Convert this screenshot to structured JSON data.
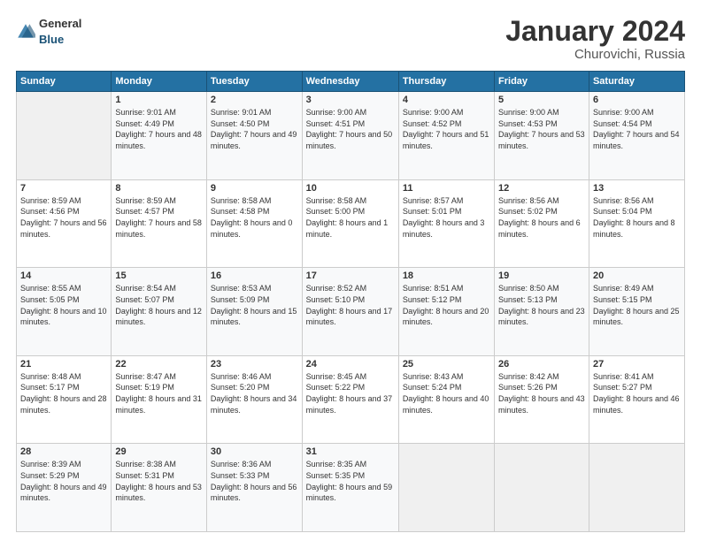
{
  "header": {
    "logo": {
      "general": "General",
      "blue": "Blue"
    },
    "title": "January 2024",
    "location": "Churovichi, Russia"
  },
  "days_of_week": [
    "Sunday",
    "Monday",
    "Tuesday",
    "Wednesday",
    "Thursday",
    "Friday",
    "Saturday"
  ],
  "weeks": [
    [
      {
        "day": "",
        "empty": true
      },
      {
        "day": "1",
        "sunrise": "Sunrise: 9:01 AM",
        "sunset": "Sunset: 4:49 PM",
        "daylight": "Daylight: 7 hours and 48 minutes."
      },
      {
        "day": "2",
        "sunrise": "Sunrise: 9:01 AM",
        "sunset": "Sunset: 4:50 PM",
        "daylight": "Daylight: 7 hours and 49 minutes."
      },
      {
        "day": "3",
        "sunrise": "Sunrise: 9:00 AM",
        "sunset": "Sunset: 4:51 PM",
        "daylight": "Daylight: 7 hours and 50 minutes."
      },
      {
        "day": "4",
        "sunrise": "Sunrise: 9:00 AM",
        "sunset": "Sunset: 4:52 PM",
        "daylight": "Daylight: 7 hours and 51 minutes."
      },
      {
        "day": "5",
        "sunrise": "Sunrise: 9:00 AM",
        "sunset": "Sunset: 4:53 PM",
        "daylight": "Daylight: 7 hours and 53 minutes."
      },
      {
        "day": "6",
        "sunrise": "Sunrise: 9:00 AM",
        "sunset": "Sunset: 4:54 PM",
        "daylight": "Daylight: 7 hours and 54 minutes."
      }
    ],
    [
      {
        "day": "7",
        "sunrise": "Sunrise: 8:59 AM",
        "sunset": "Sunset: 4:56 PM",
        "daylight": "Daylight: 7 hours and 56 minutes."
      },
      {
        "day": "8",
        "sunrise": "Sunrise: 8:59 AM",
        "sunset": "Sunset: 4:57 PM",
        "daylight": "Daylight: 7 hours and 58 minutes."
      },
      {
        "day": "9",
        "sunrise": "Sunrise: 8:58 AM",
        "sunset": "Sunset: 4:58 PM",
        "daylight": "Daylight: 8 hours and 0 minutes."
      },
      {
        "day": "10",
        "sunrise": "Sunrise: 8:58 AM",
        "sunset": "Sunset: 5:00 PM",
        "daylight": "Daylight: 8 hours and 1 minute."
      },
      {
        "day": "11",
        "sunrise": "Sunrise: 8:57 AM",
        "sunset": "Sunset: 5:01 PM",
        "daylight": "Daylight: 8 hours and 3 minutes."
      },
      {
        "day": "12",
        "sunrise": "Sunrise: 8:56 AM",
        "sunset": "Sunset: 5:02 PM",
        "daylight": "Daylight: 8 hours and 6 minutes."
      },
      {
        "day": "13",
        "sunrise": "Sunrise: 8:56 AM",
        "sunset": "Sunset: 5:04 PM",
        "daylight": "Daylight: 8 hours and 8 minutes."
      }
    ],
    [
      {
        "day": "14",
        "sunrise": "Sunrise: 8:55 AM",
        "sunset": "Sunset: 5:05 PM",
        "daylight": "Daylight: 8 hours and 10 minutes."
      },
      {
        "day": "15",
        "sunrise": "Sunrise: 8:54 AM",
        "sunset": "Sunset: 5:07 PM",
        "daylight": "Daylight: 8 hours and 12 minutes."
      },
      {
        "day": "16",
        "sunrise": "Sunrise: 8:53 AM",
        "sunset": "Sunset: 5:09 PM",
        "daylight": "Daylight: 8 hours and 15 minutes."
      },
      {
        "day": "17",
        "sunrise": "Sunrise: 8:52 AM",
        "sunset": "Sunset: 5:10 PM",
        "daylight": "Daylight: 8 hours and 17 minutes."
      },
      {
        "day": "18",
        "sunrise": "Sunrise: 8:51 AM",
        "sunset": "Sunset: 5:12 PM",
        "daylight": "Daylight: 8 hours and 20 minutes."
      },
      {
        "day": "19",
        "sunrise": "Sunrise: 8:50 AM",
        "sunset": "Sunset: 5:13 PM",
        "daylight": "Daylight: 8 hours and 23 minutes."
      },
      {
        "day": "20",
        "sunrise": "Sunrise: 8:49 AM",
        "sunset": "Sunset: 5:15 PM",
        "daylight": "Daylight: 8 hours and 25 minutes."
      }
    ],
    [
      {
        "day": "21",
        "sunrise": "Sunrise: 8:48 AM",
        "sunset": "Sunset: 5:17 PM",
        "daylight": "Daylight: 8 hours and 28 minutes."
      },
      {
        "day": "22",
        "sunrise": "Sunrise: 8:47 AM",
        "sunset": "Sunset: 5:19 PM",
        "daylight": "Daylight: 8 hours and 31 minutes."
      },
      {
        "day": "23",
        "sunrise": "Sunrise: 8:46 AM",
        "sunset": "Sunset: 5:20 PM",
        "daylight": "Daylight: 8 hours and 34 minutes."
      },
      {
        "day": "24",
        "sunrise": "Sunrise: 8:45 AM",
        "sunset": "Sunset: 5:22 PM",
        "daylight": "Daylight: 8 hours and 37 minutes."
      },
      {
        "day": "25",
        "sunrise": "Sunrise: 8:43 AM",
        "sunset": "Sunset: 5:24 PM",
        "daylight": "Daylight: 8 hours and 40 minutes."
      },
      {
        "day": "26",
        "sunrise": "Sunrise: 8:42 AM",
        "sunset": "Sunset: 5:26 PM",
        "daylight": "Daylight: 8 hours and 43 minutes."
      },
      {
        "day": "27",
        "sunrise": "Sunrise: 8:41 AM",
        "sunset": "Sunset: 5:27 PM",
        "daylight": "Daylight: 8 hours and 46 minutes."
      }
    ],
    [
      {
        "day": "28",
        "sunrise": "Sunrise: 8:39 AM",
        "sunset": "Sunset: 5:29 PM",
        "daylight": "Daylight: 8 hours and 49 minutes."
      },
      {
        "day": "29",
        "sunrise": "Sunrise: 8:38 AM",
        "sunset": "Sunset: 5:31 PM",
        "daylight": "Daylight: 8 hours and 53 minutes."
      },
      {
        "day": "30",
        "sunrise": "Sunrise: 8:36 AM",
        "sunset": "Sunset: 5:33 PM",
        "daylight": "Daylight: 8 hours and 56 minutes."
      },
      {
        "day": "31",
        "sunrise": "Sunrise: 8:35 AM",
        "sunset": "Sunset: 5:35 PM",
        "daylight": "Daylight: 8 hours and 59 minutes."
      },
      {
        "day": "",
        "empty": true
      },
      {
        "day": "",
        "empty": true
      },
      {
        "day": "",
        "empty": true
      }
    ]
  ]
}
